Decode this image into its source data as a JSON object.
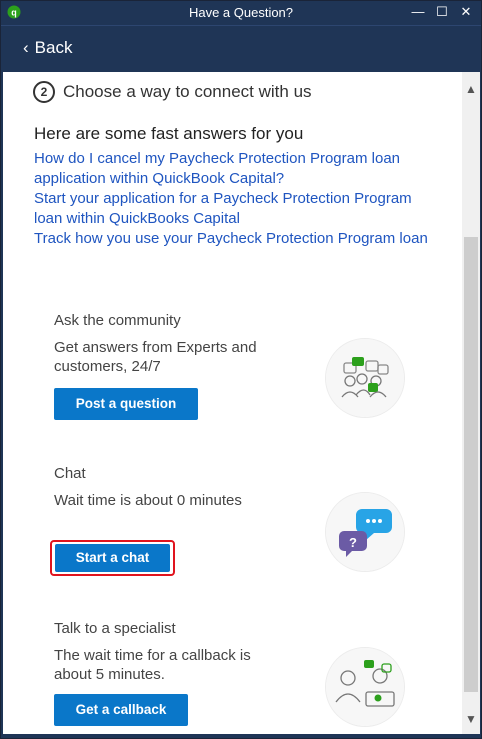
{
  "window": {
    "title": "Have a Question?",
    "minimize": "—",
    "maximize": "☐",
    "close": "✕"
  },
  "nav": {
    "back_label": "Back"
  },
  "step": {
    "number": "2",
    "label": "Choose a way to connect with us"
  },
  "fast_answers": {
    "title": "Here are some fast answers for you",
    "links": [
      "How do I cancel my Paycheck Protection Program loan application within QuickBook Capital?",
      "Start your application for a Paycheck Protection Program loan within QuickBooks Capital",
      "Track how you use your Paycheck Protection Program loan"
    ]
  },
  "community": {
    "heading": "Ask the community",
    "description": "Get answers from Experts and customers, 24/7",
    "button": "Post a question"
  },
  "chat": {
    "heading": "Chat",
    "description": "Wait time is about 0 minutes",
    "button": "Start a chat"
  },
  "specialist": {
    "heading": "Talk to a specialist",
    "description": "The wait time for a callback is about 5 minutes.",
    "button": "Get a callback"
  },
  "colors": {
    "titlebar": "#1f3556",
    "button": "#0a77c9",
    "link": "#1f55c0",
    "highlight": "#e0141e"
  }
}
